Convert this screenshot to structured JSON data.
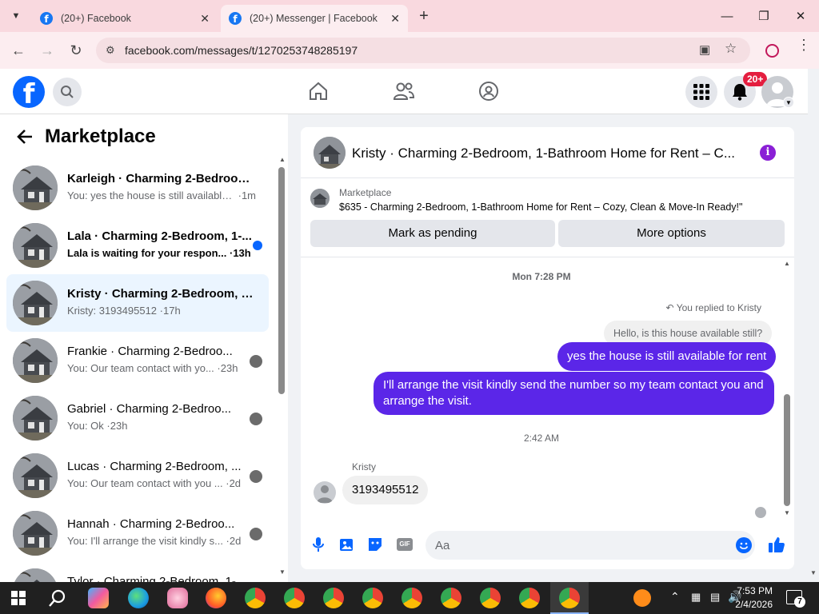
{
  "browser": {
    "tabs": [
      {
        "title": "(20+) Facebook",
        "active": false
      },
      {
        "title": "(20+) Messenger | Facebook",
        "active": true
      }
    ],
    "url": "facebook.com/messages/t/1270253748285197"
  },
  "fb_header": {
    "notification_badge": "20+"
  },
  "sidebar": {
    "title": "Marketplace",
    "conversations": [
      {
        "name": "Karleigh · Charming 2-Bedroom,...",
        "preview": "You: yes the house is still available ...",
        "time": "1m",
        "unread": false,
        "selected": false
      },
      {
        "name": "Lala · Charming 2-Bedroom, 1-...",
        "preview": "Lala is waiting for your respon...",
        "time": "13h",
        "unread": true,
        "selected": false
      },
      {
        "name": "Kristy · Charming 2-Bedroom, 1-...",
        "preview": "Kristy: 3193495512",
        "time": "17h",
        "unread": false,
        "selected": true
      },
      {
        "name": "Frankie · Charming 2-Bedroo...",
        "preview": "You: Our team contact with yo...",
        "time": "23h",
        "unread": false,
        "selected": false
      },
      {
        "name": "Gabriel · Charming 2-Bedroo...",
        "preview": "You: Ok",
        "time": "23h",
        "unread": false,
        "selected": false
      },
      {
        "name": "Lucas · Charming 2-Bedroom, ...",
        "preview": "You: Our team contact with you ...",
        "time": "2d",
        "unread": false,
        "selected": false
      },
      {
        "name": "Hannah · Charming 2-Bedroo...",
        "preview": "You: I'll arrange the visit kindly s...",
        "time": "2d",
        "unread": false,
        "selected": false
      },
      {
        "name": "Tylor · Charming 2-Bedroom, 1-...",
        "preview": "",
        "time": "",
        "unread": false,
        "selected": false
      }
    ]
  },
  "chat": {
    "header_title": "Kristy · Charming 2-Bedroom, 1-Bathroom Home for Rent – C...",
    "listing_label": "Marketplace",
    "listing_title": "$635 - Charming 2-Bedroom, 1-Bathroom Home for Rent – Cozy, Clean & Move-In Ready!\"",
    "mark_pending": "Mark as pending",
    "more_options": "More options",
    "timestamp1": "Mon 7:28 PM",
    "replied_to": "You replied to Kristy",
    "quoted_msg": "Hello, is this house available still?",
    "msg_out1": "yes the house is still available for rent",
    "msg_out2": "I'll arrange the visit kindly send the number so my team contact you and arrange the visit.",
    "timestamp2": "2:42 AM",
    "sender_name": "Kristy",
    "msg_in1": "3193495512",
    "input_placeholder": "Aa"
  },
  "taskbar": {
    "time": "7:53 PM",
    "date": "2/4/2026",
    "notification_count": "7"
  },
  "colors": {
    "fb_blue": "#0866ff",
    "outgoing_bubble": "#5b26e8",
    "browser_frame": "#f9d9df"
  }
}
